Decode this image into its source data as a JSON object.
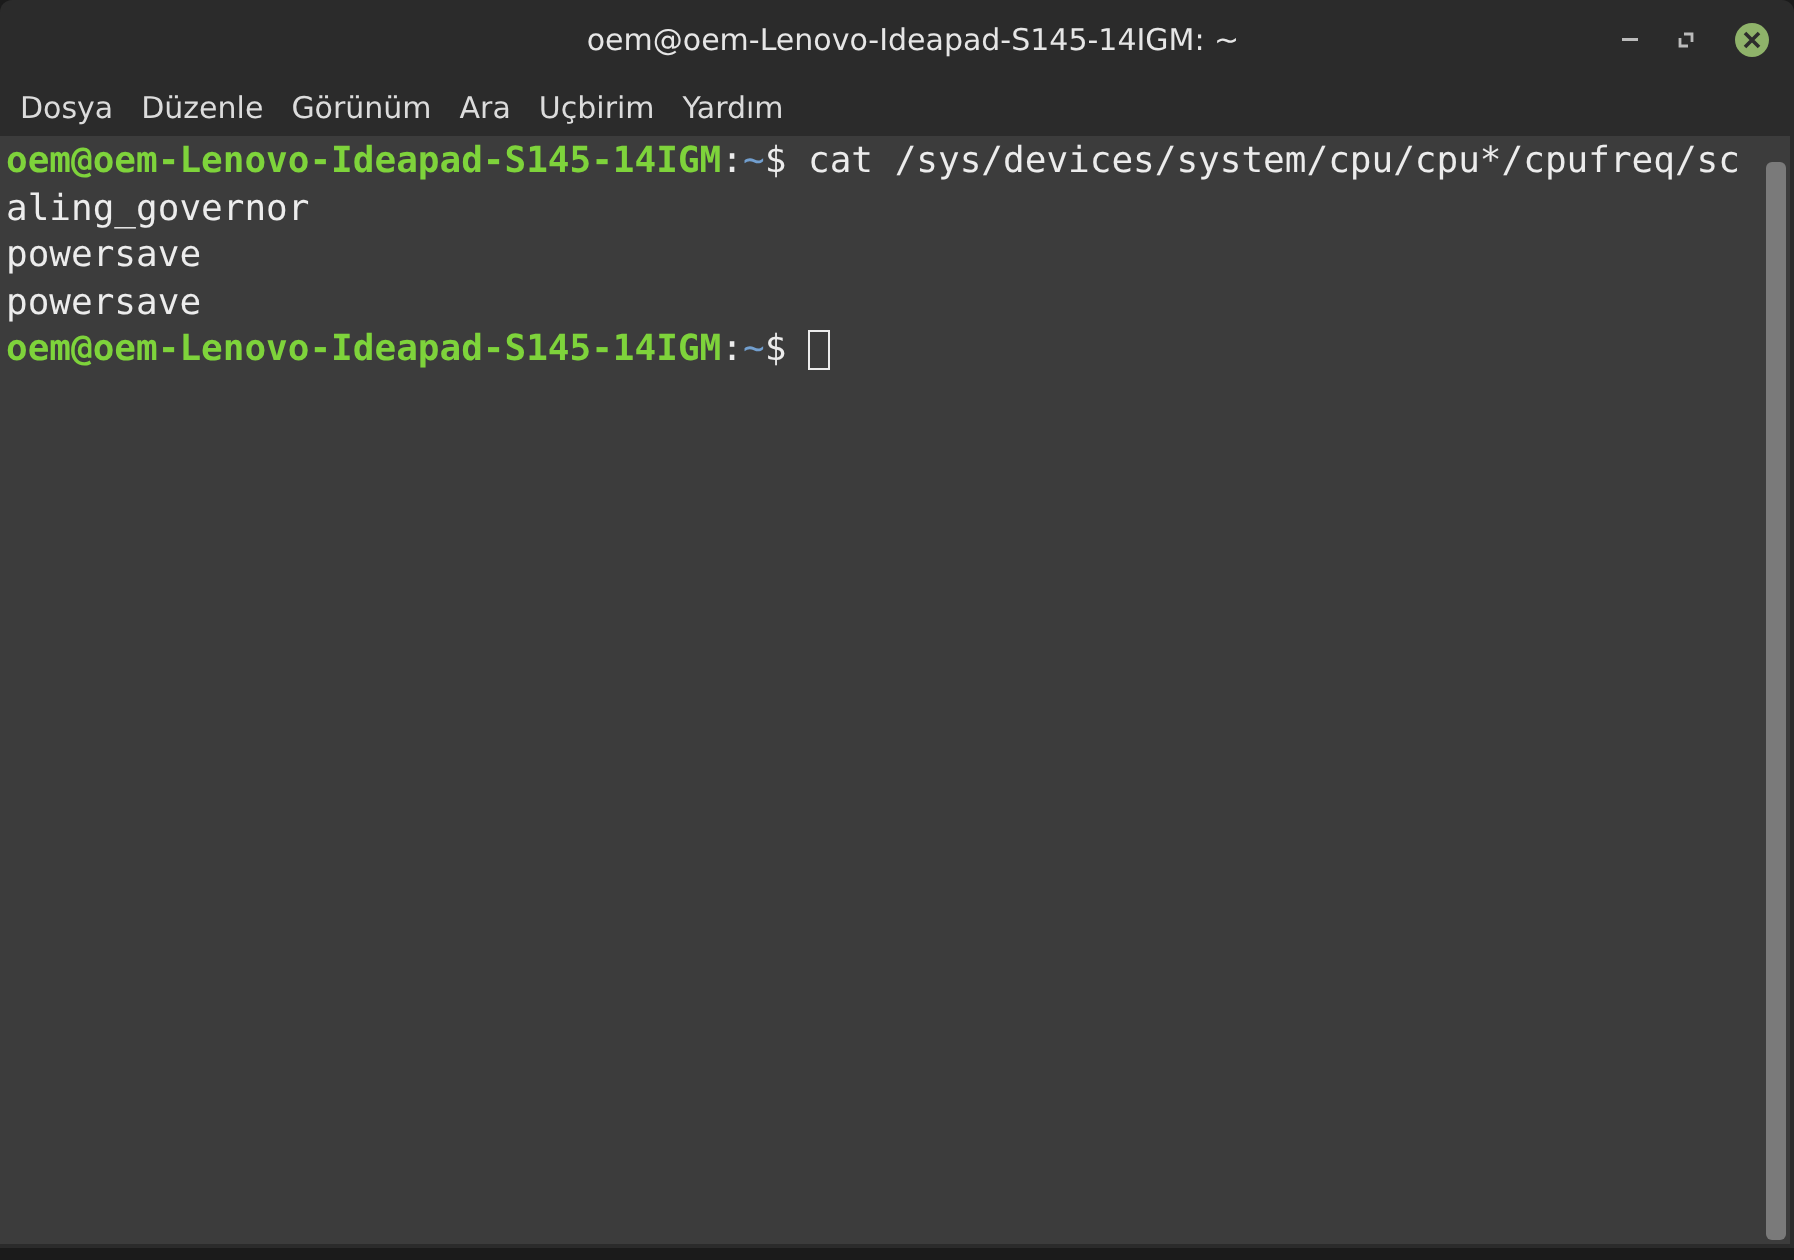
{
  "window": {
    "title": "oem@oem-Lenovo-Ideapad-S145-14IGM: ~"
  },
  "menu": [
    "Dosya",
    "Düzenle",
    "Görünüm",
    "Ara",
    "Uçbirim",
    "Yardım"
  ],
  "terminal": {
    "lines": [
      {
        "cursor": false,
        "segments": [
          {
            "kind": "host",
            "text": "oem@oem-Lenovo-Ideapad-S145-14IGM"
          },
          {
            "kind": "plain",
            "text": ":"
          },
          {
            "kind": "path",
            "text": "~"
          },
          {
            "kind": "plain",
            "text": "$ cat /sys/devices/system/cpu/cpu*/cpufreq/sc"
          }
        ]
      },
      {
        "cursor": false,
        "segments": [
          {
            "kind": "plain",
            "text": "aling_governor"
          }
        ]
      },
      {
        "cursor": false,
        "segments": [
          {
            "kind": "plain",
            "text": "powersave"
          }
        ]
      },
      {
        "cursor": false,
        "segments": [
          {
            "kind": "plain",
            "text": "powersave"
          }
        ]
      },
      {
        "cursor": true,
        "segments": [
          {
            "kind": "host",
            "text": "oem@oem-Lenovo-Ideapad-S145-14IGM"
          },
          {
            "kind": "plain",
            "text": ":"
          },
          {
            "kind": "path",
            "text": "~"
          },
          {
            "kind": "plain",
            "text": "$ "
          }
        ]
      }
    ]
  }
}
